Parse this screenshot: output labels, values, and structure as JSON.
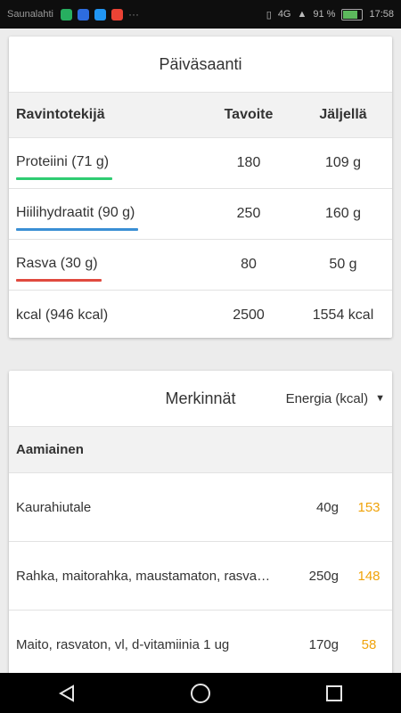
{
  "status_bar": {
    "carrier": "Saunalahti",
    "network": "4G",
    "battery": "91 %",
    "time": "17:58",
    "icon_colors": [
      "#27ae60",
      "#2d6cdf",
      "#2196f3",
      "#ea4335"
    ]
  },
  "daily": {
    "title": "Päiväsaanti",
    "headers": {
      "nutrient": "Ravintotekijä",
      "target": "Tavoite",
      "remaining": "Jäljellä"
    },
    "rows": [
      {
        "label": "Proteiini (71 g)",
        "target": "180",
        "remaining": "109 g",
        "color": "#2ecc71"
      },
      {
        "label": "Hiilihydraatit (90 g)",
        "target": "250",
        "remaining": "160 g",
        "color": "#3b8fd4"
      },
      {
        "label": "Rasva (30 g)",
        "target": "80",
        "remaining": "50 g",
        "color": "#e04a3f"
      },
      {
        "label": "kcal (946 kcal)",
        "target": "2500",
        "remaining": "1554 kcal",
        "color": null
      }
    ]
  },
  "entries": {
    "title": "Merkinnät",
    "selector": "Energia (kcal)",
    "section": "Aamiainen",
    "items": [
      {
        "name": "Kaurahiutale",
        "amount": "40g",
        "kcal": "153"
      },
      {
        "name": "Rahka, maitorahka, maustamaton, rasva…",
        "amount": "250g",
        "kcal": "148"
      },
      {
        "name": "Maito, rasvaton, vl, d-vitamiinia 1 ug",
        "amount": "170g",
        "kcal": "58"
      }
    ]
  },
  "nav": {
    "back": "back-icon",
    "home": "home-icon",
    "recents": "recents-icon"
  }
}
